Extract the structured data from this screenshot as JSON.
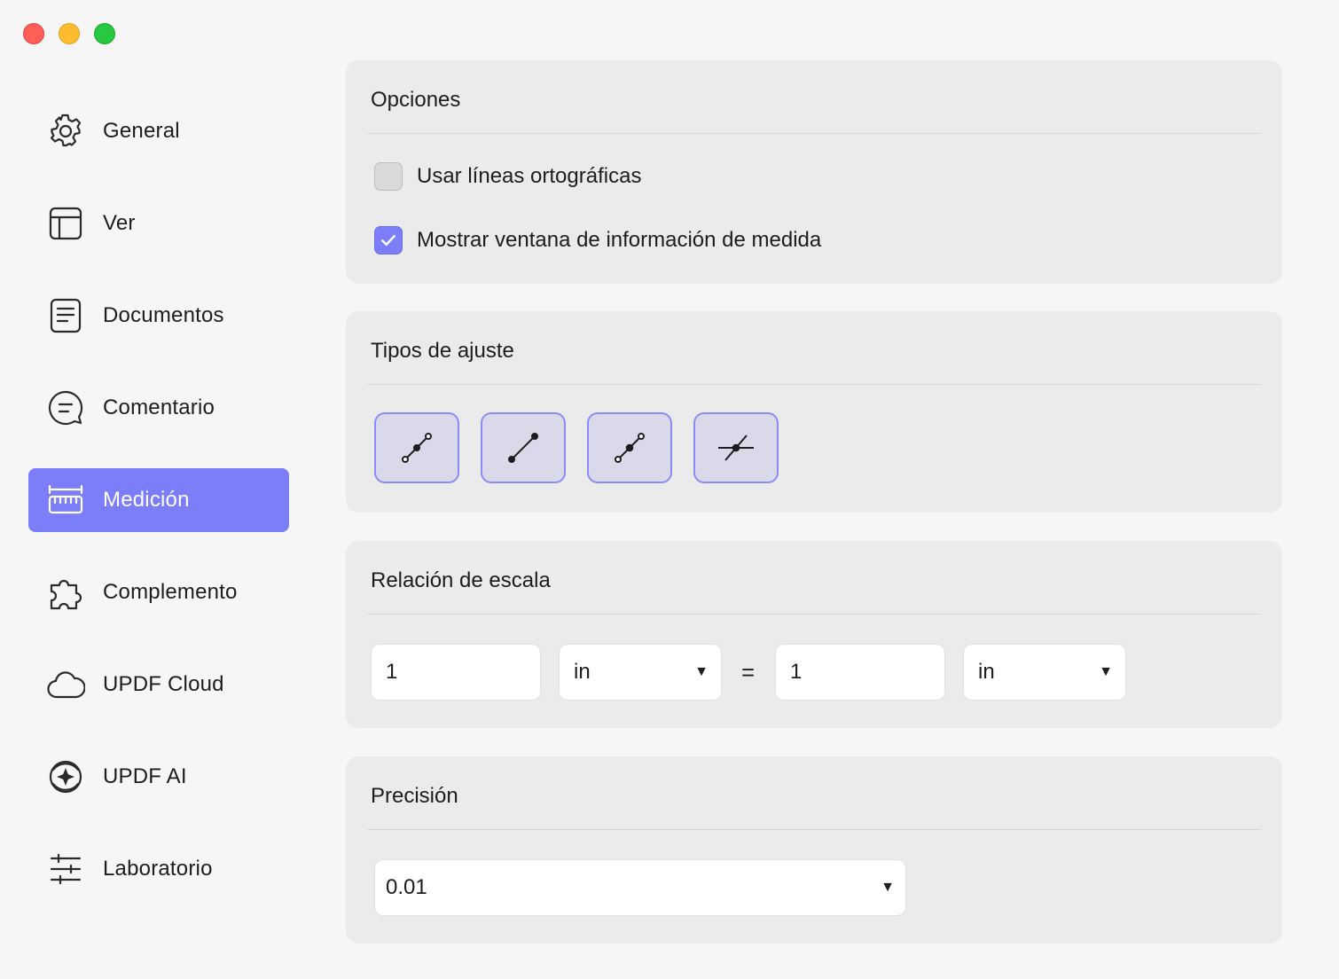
{
  "window": {
    "controls": [
      "close",
      "minimize",
      "zoom"
    ]
  },
  "sidebar": {
    "items": [
      {
        "label": "General",
        "icon": "gear-icon"
      },
      {
        "label": "Ver",
        "icon": "layout-icon"
      },
      {
        "label": "Documentos",
        "icon": "document-icon"
      },
      {
        "label": "Comentario",
        "icon": "comment-icon"
      },
      {
        "label": "Medición",
        "icon": "ruler-icon",
        "active": true
      },
      {
        "label": "Complemento",
        "icon": "puzzle-icon"
      },
      {
        "label": "UPDF Cloud",
        "icon": "cloud-icon"
      },
      {
        "label": "UPDF AI",
        "icon": "ai-icon"
      },
      {
        "label": "Laboratorio",
        "icon": "sliders-icon"
      }
    ]
  },
  "options": {
    "title": "Opciones",
    "orthographic_label": "Usar líneas ortográficas",
    "orthographic_checked": false,
    "show_info_label": "Mostrar ventana de información de medida",
    "show_info_checked": true
  },
  "snap": {
    "title": "Tipos de ajuste",
    "buttons": [
      "snap-to-paths-icon",
      "snap-to-endpoints-icon",
      "snap-to-midpoints-icon",
      "snap-to-intersections-icon"
    ]
  },
  "scale": {
    "title": "Relación de escala",
    "left_value": "1",
    "left_unit": "in",
    "equals": "=",
    "right_value": "1",
    "right_unit": "in"
  },
  "precision": {
    "title": "Precisión",
    "value": "0.01"
  },
  "colors": {
    "accent": "#7b7ef8",
    "close": "#ff5f57",
    "minimize": "#febc2e",
    "zoom": "#28c840"
  }
}
